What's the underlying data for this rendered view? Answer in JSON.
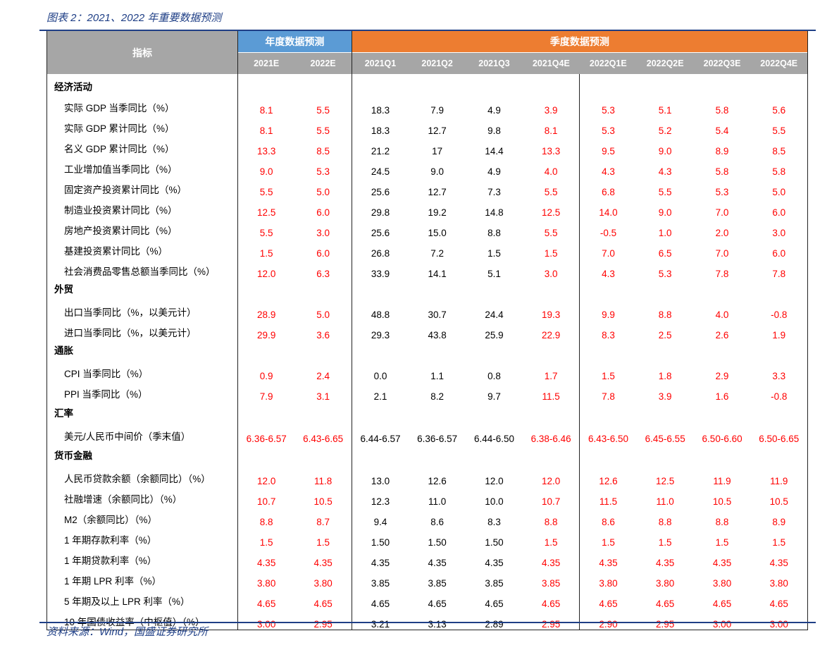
{
  "figure_title": "图表 2：2021、2022 年重要数据预测",
  "source": "资料来源：Wind，国盛证券研究所",
  "colors": {
    "annual_header": "#5b9bd5",
    "quarter_header": "#ed7d31",
    "sub_header": "#a6a6a6",
    "forecast_value": "#ff0000",
    "actual_value": "#000000",
    "rule": "#1f3f86"
  },
  "header": {
    "indicator": "指标",
    "annual_group": "年度数据预测",
    "quarter_group": "季度数据预测",
    "columns": [
      "2021E",
      "2022E",
      "2021Q1",
      "2021Q2",
      "2021Q3",
      "2021Q4E",
      "2022Q1E",
      "2022Q2E",
      "2022Q3E",
      "2022Q4E"
    ]
  },
  "rows": [
    {
      "type": "category",
      "label": "经济活动"
    },
    {
      "type": "item",
      "label": "实际 GDP 当季同比（%）",
      "values": [
        "8.1",
        "5.5",
        "18.3",
        "7.9",
        "4.9",
        "3.9",
        "5.3",
        "5.1",
        "5.8",
        "5.6"
      ]
    },
    {
      "type": "item",
      "label": "实际 GDP 累计同比（%）",
      "values": [
        "8.1",
        "5.5",
        "18.3",
        "12.7",
        "9.8",
        "8.1",
        "5.3",
        "5.2",
        "5.4",
        "5.5"
      ]
    },
    {
      "type": "item",
      "label": "名义 GDP 累计同比（%）",
      "values": [
        "13.3",
        "8.5",
        "21.2",
        "17",
        "14.4",
        "13.3",
        "9.5",
        "9.0",
        "8.9",
        "8.5"
      ]
    },
    {
      "type": "item",
      "label": "工业增加值当季同比（%）",
      "values": [
        "9.0",
        "5.3",
        "24.5",
        "9.0",
        "4.9",
        "4.0",
        "4.3",
        "4.3",
        "5.8",
        "5.8"
      ]
    },
    {
      "type": "item",
      "label": "固定资产投资累计同比（%）",
      "values": [
        "5.5",
        "5.0",
        "25.6",
        "12.7",
        "7.3",
        "5.5",
        "6.8",
        "5.5",
        "5.3",
        "5.0"
      ]
    },
    {
      "type": "item",
      "label": "制造业投资累计同比（%）",
      "values": [
        "12.5",
        "6.0",
        "29.8",
        "19.2",
        "14.8",
        "12.5",
        "14.0",
        "9.0",
        "7.0",
        "6.0"
      ]
    },
    {
      "type": "item",
      "label": "房地产投资累计同比（%）",
      "values": [
        "5.5",
        "3.0",
        "25.6",
        "15.0",
        "8.8",
        "5.5",
        "-0.5",
        "1.0",
        "2.0",
        "3.0"
      ]
    },
    {
      "type": "item",
      "label": "基建投资累计同比（%）",
      "values": [
        "1.5",
        "6.0",
        "26.8",
        "7.2",
        "1.5",
        "1.5",
        "7.0",
        "6.5",
        "7.0",
        "6.0"
      ]
    },
    {
      "type": "item",
      "label": "社会消费品零售总额当季同比（%）",
      "values": [
        "12.0",
        "6.3",
        "33.9",
        "14.1",
        "5.1",
        "3.0",
        "4.3",
        "5.3",
        "7.8",
        "7.8"
      ]
    },
    {
      "type": "category",
      "label": "外贸"
    },
    {
      "type": "item",
      "label": "出口当季同比（%，以美元计）",
      "values": [
        "28.9",
        "5.0",
        "48.8",
        "30.7",
        "24.4",
        "19.3",
        "9.9",
        "8.8",
        "4.0",
        "-0.8"
      ]
    },
    {
      "type": "item",
      "label": "进口当季同比（%，以美元计）",
      "values": [
        "29.9",
        "3.6",
        "29.3",
        "43.8",
        "25.9",
        "22.9",
        "8.3",
        "2.5",
        "2.6",
        "1.9"
      ]
    },
    {
      "type": "category",
      "label": "通胀"
    },
    {
      "type": "item",
      "label": "CPI 当季同比（%）",
      "values": [
        "0.9",
        "2.4",
        "0.0",
        "1.1",
        "0.8",
        "1.7",
        "1.5",
        "1.8",
        "2.9",
        "3.3"
      ]
    },
    {
      "type": "item",
      "label": "PPI 当季同比（%）",
      "values": [
        "7.9",
        "3.1",
        "2.1",
        "8.2",
        "9.7",
        "11.5",
        "7.8",
        "3.9",
        "1.6",
        "-0.8"
      ]
    },
    {
      "type": "category",
      "label": "汇率"
    },
    {
      "type": "item",
      "label": "美元/人民币中间价（季末值）",
      "values": [
        "6.36-6.57",
        "6.43-6.65",
        "6.44-6.57",
        "6.36-6.57",
        "6.44-6.50",
        "6.38-6.46",
        "6.43-6.50",
        "6.45-6.55",
        "6.50-6.60",
        "6.50-6.65"
      ]
    },
    {
      "type": "category",
      "label": "货币金融"
    },
    {
      "type": "item",
      "label": "人民币贷款余额（余额同比）（%）",
      "values": [
        "12.0",
        "11.8",
        "13.0",
        "12.6",
        "12.0",
        "12.0",
        "12.6",
        "12.5",
        "11.9",
        "11.9"
      ]
    },
    {
      "type": "item",
      "label": "社融增速（余额同比）（%）",
      "values": [
        "10.7",
        "10.5",
        "12.3",
        "11.0",
        "10.0",
        "10.7",
        "11.5",
        "11.0",
        "10.5",
        "10.5"
      ]
    },
    {
      "type": "item",
      "label": "M2（余额同比）（%）",
      "values": [
        "8.8",
        "8.7",
        "9.4",
        "8.6",
        "8.3",
        "8.8",
        "8.6",
        "8.8",
        "8.8",
        "8.9"
      ]
    },
    {
      "type": "item",
      "label": "1 年期存款利率（%）",
      "values": [
        "1.5",
        "1.5",
        "1.50",
        "1.50",
        "1.50",
        "1.5",
        "1.5",
        "1.5",
        "1.5",
        "1.5"
      ]
    },
    {
      "type": "item",
      "label": "1 年期贷款利率（%）",
      "values": [
        "4.35",
        "4.35",
        "4.35",
        "4.35",
        "4.35",
        "4.35",
        "4.35",
        "4.35",
        "4.35",
        "4.35"
      ]
    },
    {
      "type": "item",
      "label": "1 年期 LPR 利率（%）",
      "values": [
        "3.80",
        "3.80",
        "3.85",
        "3.85",
        "3.85",
        "3.85",
        "3.80",
        "3.80",
        "3.80",
        "3.80"
      ]
    },
    {
      "type": "item",
      "label": "5 年期及以上 LPR 利率（%）",
      "values": [
        "4.65",
        "4.65",
        "4.65",
        "4.65",
        "4.65",
        "4.65",
        "4.65",
        "4.65",
        "4.65",
        "4.65"
      ]
    },
    {
      "type": "item",
      "label": "10 年国债收益率（中枢值）（%）",
      "values": [
        "3.00",
        "2.95",
        "3.21",
        "3.13",
        "2.89",
        "2.95",
        "2.90",
        "2.95",
        "3.00",
        "3.00"
      ]
    }
  ]
}
